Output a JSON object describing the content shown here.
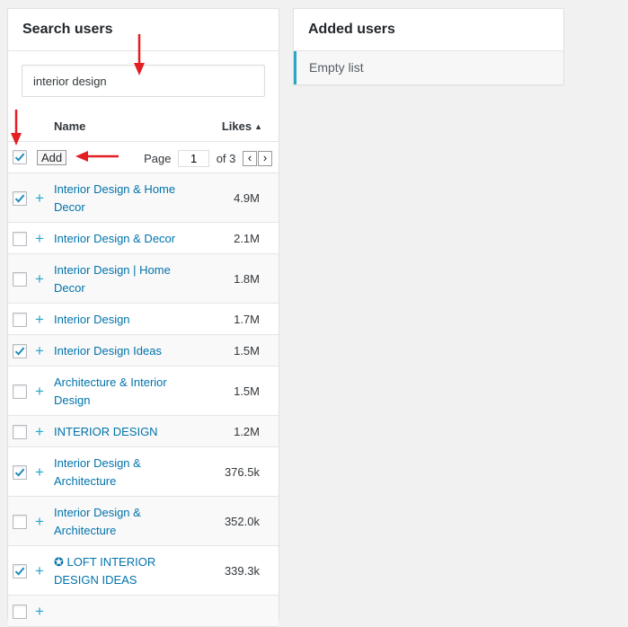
{
  "search_panel": {
    "title": "Search users",
    "search_value": "interior design",
    "col_name": "Name",
    "col_likes": "Likes",
    "add_label": "Add",
    "page_label": "Page",
    "page_value": "1",
    "of_label": "of 3",
    "prev_symbol": "‹",
    "next_symbol": "›"
  },
  "results": [
    {
      "name": "Interior Design & Home Decor",
      "likes": "4.9M",
      "checked": true,
      "lines": 2
    },
    {
      "name": "Interior Design & Decor",
      "likes": "2.1M",
      "checked": false,
      "lines": 1
    },
    {
      "name": "Interior Design | Home Decor",
      "likes": "1.8M",
      "checked": false,
      "lines": 2
    },
    {
      "name": "Interior Design",
      "likes": "1.7M",
      "checked": false,
      "lines": 1
    },
    {
      "name": "Interior Design Ideas",
      "likes": "1.5M",
      "checked": true,
      "lines": 1
    },
    {
      "name": "Architecture & Interior Design",
      "likes": "1.5M",
      "checked": false,
      "lines": 2
    },
    {
      "name": "INTERIOR DESIGN",
      "likes": "1.2M",
      "checked": false,
      "lines": 1
    },
    {
      "name": "Interior Design & Architecture",
      "likes": "376.5k",
      "checked": true,
      "lines": 2
    },
    {
      "name": "Interior Design & Architecture",
      "likes": "352.0k",
      "checked": false,
      "lines": 2
    },
    {
      "name": "✪ LOFT INTERIOR DESIGN IDEAS",
      "likes": "339.3k",
      "checked": true,
      "lines": 2
    },
    {
      "name": "",
      "likes": "",
      "checked": false,
      "lines": 1
    }
  ],
  "select_all_checked": true,
  "added_panel": {
    "title": "Added users",
    "empty_text": "Empty list"
  },
  "colors": {
    "accent": "#2aa4c7",
    "link": "#0073aa",
    "annotation_arrow": "#e31e24"
  }
}
